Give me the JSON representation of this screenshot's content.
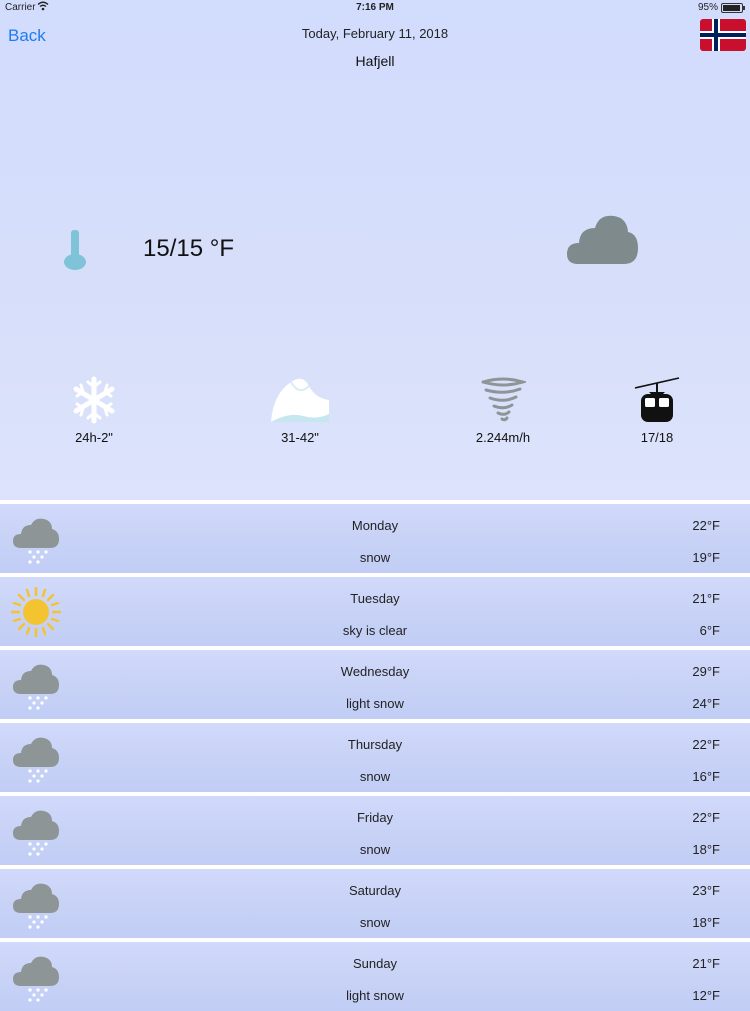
{
  "status_bar": {
    "carrier": "Carrier",
    "time": "7:16 PM",
    "battery": "95%",
    "battery_level": 0.95
  },
  "nav": {
    "back_label": "Back",
    "date": "Today, February 11, 2018",
    "location": "Hafjell",
    "flag_icon": "norway-flag-icon"
  },
  "current": {
    "temperature": "15/15 °F",
    "condition_icon": "cloud-icon"
  },
  "stats": {
    "snowfall_24h": "24h-2\"",
    "snow_depth": "31-42\"",
    "wind": "2.244m/h",
    "lifts": "17/18"
  },
  "forecast": [
    {
      "day": "Monday",
      "description": "snow",
      "high": "22°F",
      "low": "19°F",
      "icon": "snow-cloud-icon"
    },
    {
      "day": "Tuesday",
      "description": "sky is clear",
      "high": "21°F",
      "low": "6°F",
      "icon": "sun-icon"
    },
    {
      "day": "Wednesday",
      "description": "light snow",
      "high": "29°F",
      "low": "24°F",
      "icon": "snow-cloud-icon"
    },
    {
      "day": "Thursday",
      "description": "snow",
      "high": "22°F",
      "low": "16°F",
      "icon": "snow-cloud-icon"
    },
    {
      "day": "Friday",
      "description": "snow",
      "high": "22°F",
      "low": "18°F",
      "icon": "snow-cloud-icon"
    },
    {
      "day": "Saturday",
      "description": "snow",
      "high": "23°F",
      "low": "18°F",
      "icon": "snow-cloud-icon"
    },
    {
      "day": "Sunday",
      "description": "light snow",
      "high": "21°F",
      "low": "12°F",
      "icon": "snow-cloud-icon"
    }
  ],
  "colors": {
    "accent": "#1e7cf0",
    "panel_bg": "#d4dcfb",
    "row_bg": "#c9d3f6",
    "cloud": "#7e8a8c",
    "thermometer": "#7ec3d8",
    "sun": "#f4c430"
  }
}
